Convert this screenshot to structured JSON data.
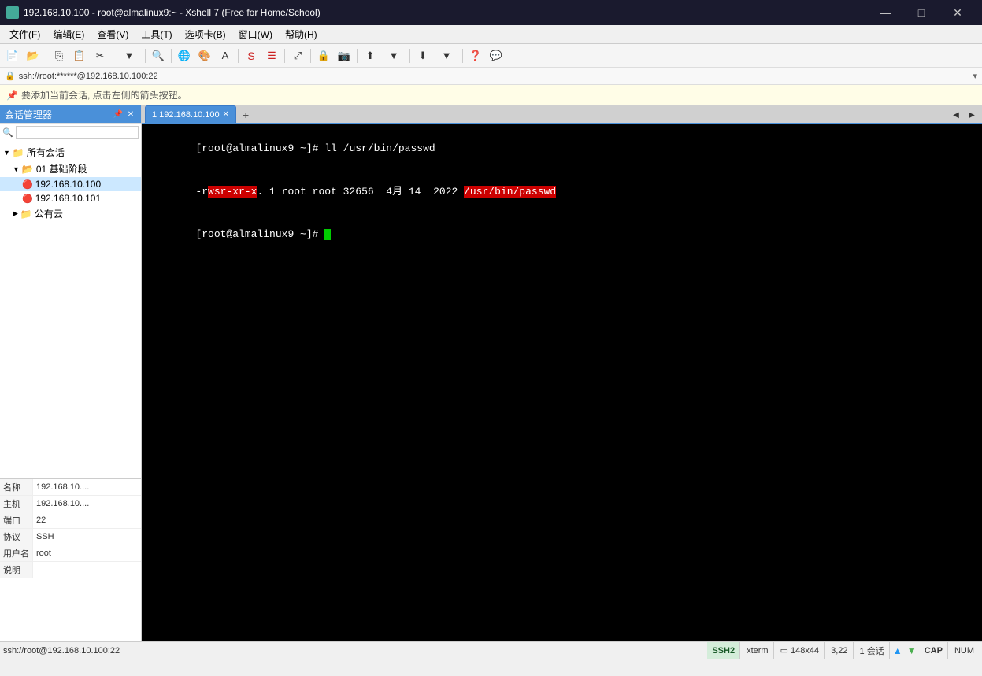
{
  "window": {
    "title": "192.168.10.100 - root@almalinux9:~ - Xshell 7 (Free for Home/School)",
    "icon": "🖥"
  },
  "menubar": {
    "items": [
      "文件(F)",
      "编辑(E)",
      "查看(V)",
      "工具(T)",
      "选项卡(B)",
      "窗口(W)",
      "帮助(H)"
    ]
  },
  "address_bar": {
    "text": "ssh://root:******@192.168.10.100:22",
    "lock_icon": "🔒"
  },
  "warn_bar": {
    "icon": "📌",
    "text": "要添加当前会话, 点击左侧的箭头按钮。"
  },
  "session_panel": {
    "title": "会话管理器",
    "tree": [
      {
        "level": 0,
        "label": "所有会话",
        "type": "root",
        "expanded": true
      },
      {
        "level": 1,
        "label": "01 基础阶段",
        "type": "folder",
        "expanded": true
      },
      {
        "level": 2,
        "label": "192.168.10.100",
        "type": "server",
        "selected": true
      },
      {
        "level": 2,
        "label": "192.168.10.101",
        "type": "server"
      },
      {
        "level": 1,
        "label": "公有云",
        "type": "folder",
        "expanded": false
      }
    ]
  },
  "session_info": {
    "rows": [
      {
        "label": "名称",
        "value": "192.168.10...."
      },
      {
        "label": "主机",
        "value": "192.168.10...."
      },
      {
        "label": "端口",
        "value": "22"
      },
      {
        "label": "协议",
        "value": "SSH"
      },
      {
        "label": "用户名",
        "value": "root"
      },
      {
        "label": "说明",
        "value": ""
      }
    ]
  },
  "tabs": [
    {
      "id": 1,
      "label": "1 192.168.10.100",
      "active": true
    }
  ],
  "terminal": {
    "lines": [
      {
        "type": "prompt_cmd",
        "prompt": "[root@almalinux9 ~]# ",
        "cmd": "ll /usr/bin/passwd"
      },
      {
        "type": "output_highlight",
        "before": "-r",
        "highlight": "wsr-xr-x",
        "after": ". 1 root root 32656  4月 14  2022 ",
        "highlight2": "/usr/bin/passwd"
      },
      {
        "type": "prompt_cursor",
        "prompt": "[root@almalinux9 ~]# "
      }
    ]
  },
  "status_bar": {
    "left_text": "ssh://root@192.168.10.100:22",
    "ssh2": "SSH2",
    "xterm": "xterm",
    "dimensions": "148x44",
    "position": "3,22",
    "sessions": "1 会话",
    "cap": "CAP",
    "num": "NUM"
  },
  "icons": {
    "minimize": "—",
    "maximize": "□",
    "close": "✕",
    "pin": "📌",
    "lock": "🔒",
    "folder_open": "📂",
    "folder_closed": "📁",
    "server": "🔴",
    "search": "🔍",
    "arrow_left": "◀",
    "arrow_right": "▶",
    "plus": "+",
    "arrow_up": "↑",
    "arrow_down": "↓",
    "chevron": "▾"
  }
}
